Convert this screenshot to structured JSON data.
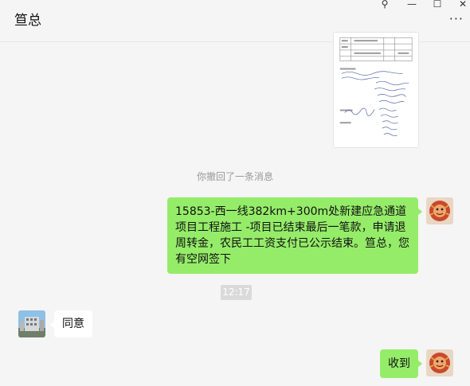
{
  "window": {
    "title": "笪总",
    "controls": {
      "pin": "⚲",
      "minimize": "—",
      "maximize": "☐",
      "close": "✕"
    },
    "more": "···"
  },
  "messages": [
    {
      "side": "right",
      "type": "image",
      "icon": "document-image"
    },
    {
      "side": "center",
      "type": "system",
      "text": "你撤回了一条消息"
    },
    {
      "side": "right",
      "type": "text",
      "text": "15853-西一线382km+300m处新建应急通道项目工程施工 -项目已结束最后一笔款，申请退周转金，农民工工资支付已公示结束。笪总，您有空网签下"
    },
    {
      "side": "center",
      "type": "time",
      "text": "12:17"
    },
    {
      "side": "left",
      "type": "text",
      "text": "同意"
    },
    {
      "side": "right",
      "type": "text",
      "text": "收到"
    }
  ],
  "colors": {
    "background": "#f5f5f5",
    "self_bubble": "#95ec69",
    "other_bubble": "#ffffff",
    "time_chip": "#dadada"
  }
}
